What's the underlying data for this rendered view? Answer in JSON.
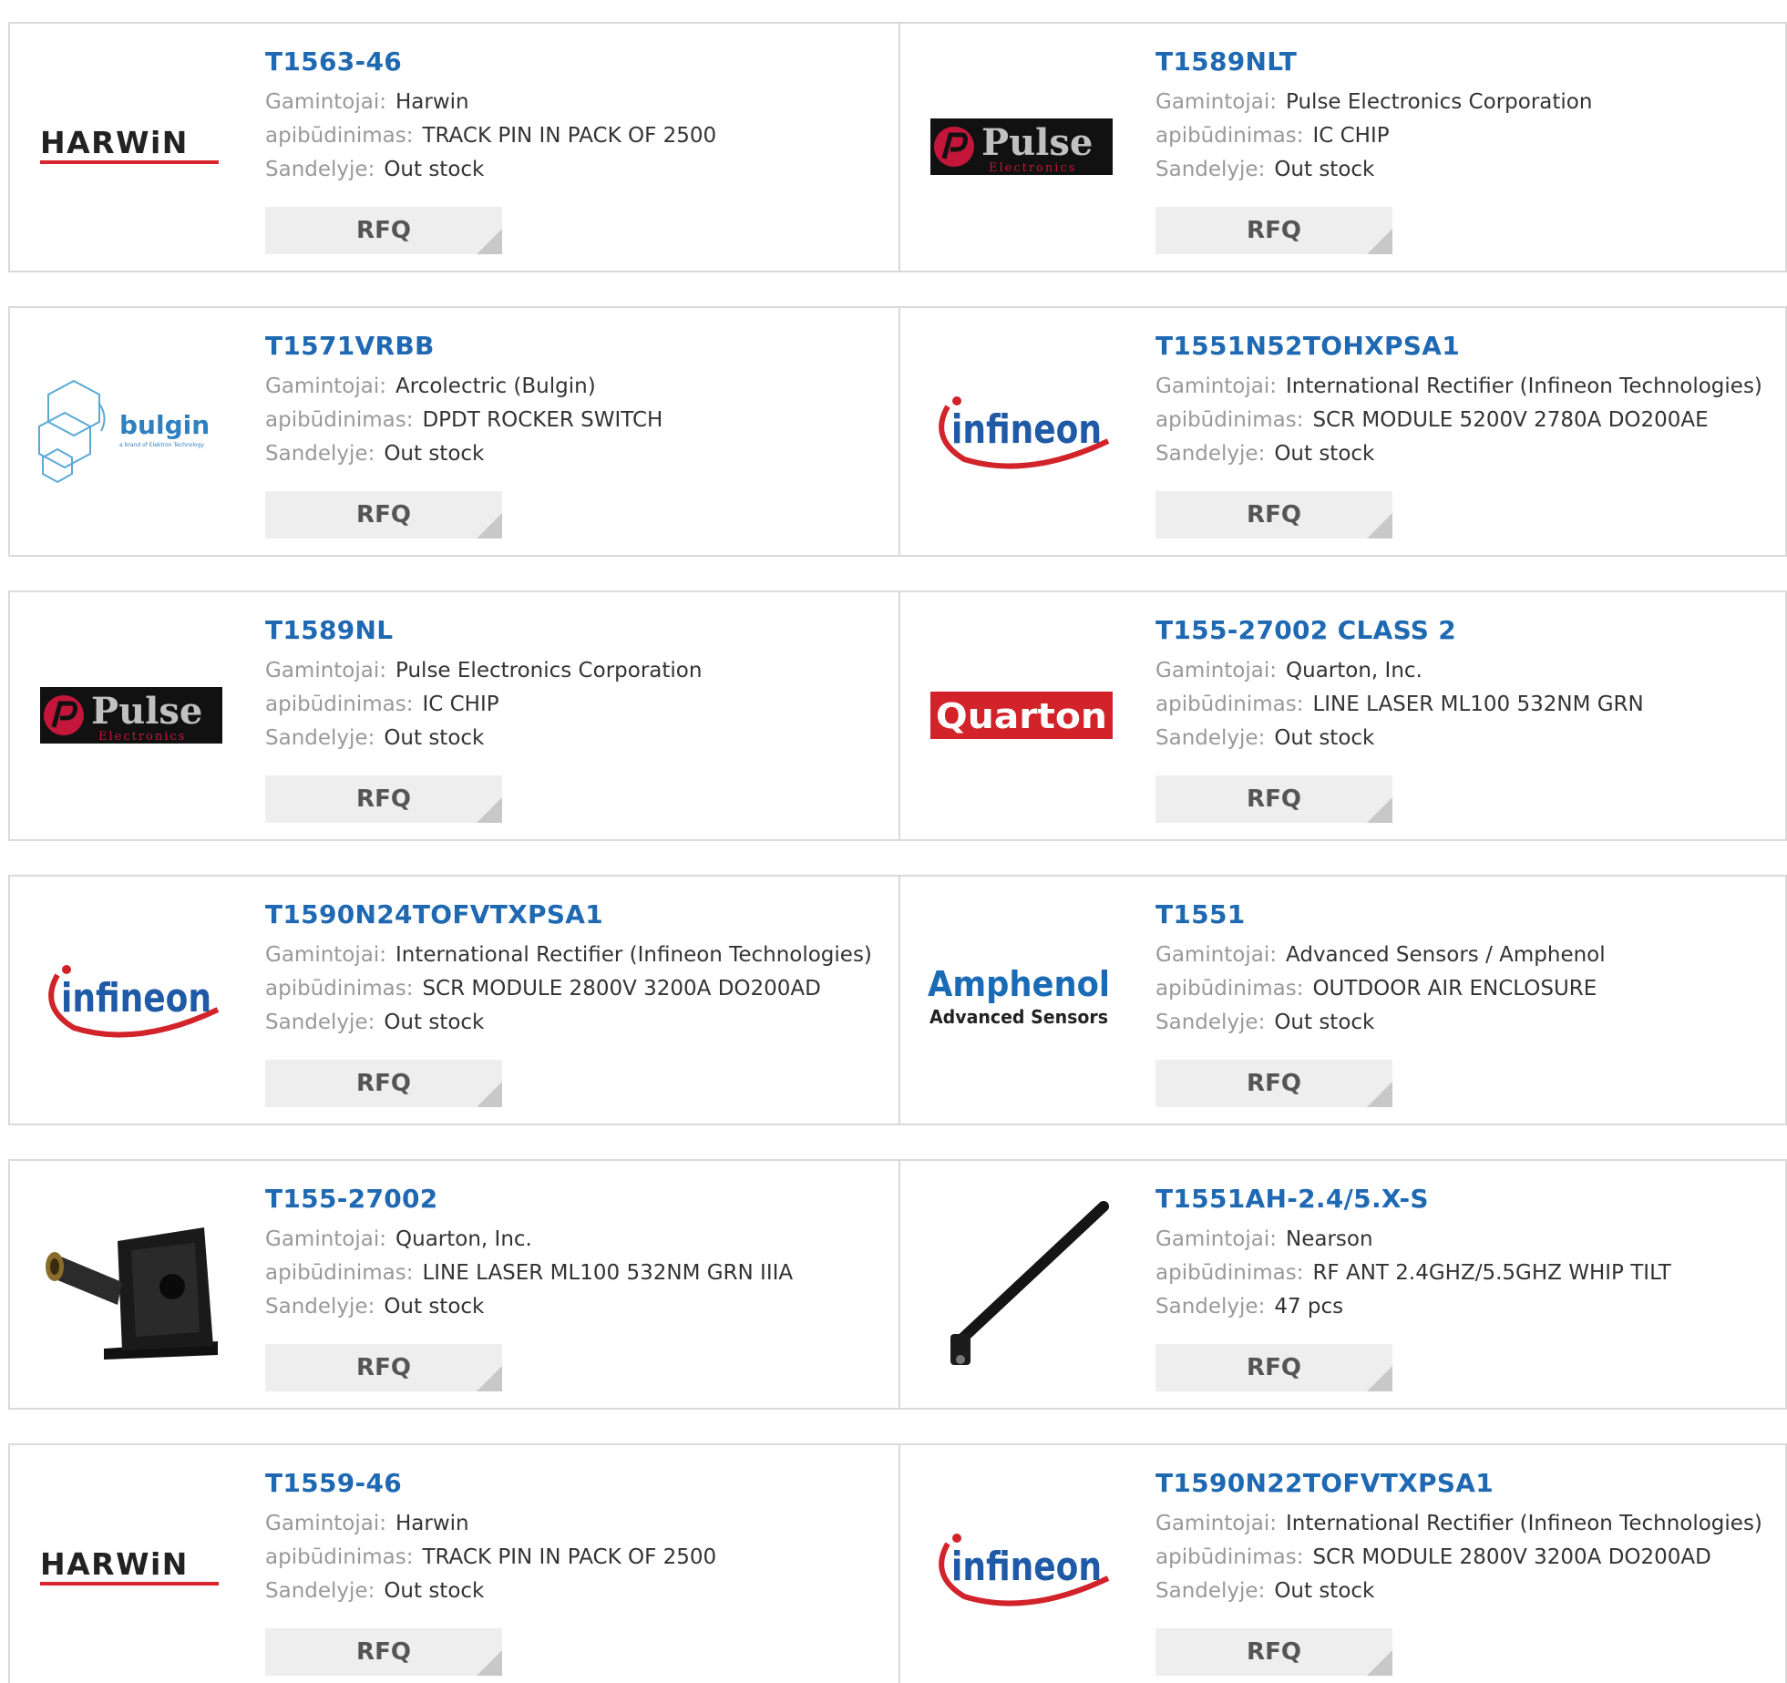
{
  "labels": {
    "manufacturer": "Gamintojai:",
    "description": "apibūdinimas:",
    "stock": "Sandelyje:",
    "rfq": "RFQ"
  },
  "products": [
    {
      "part": "T1563-46",
      "manufacturer": "Harwin",
      "description": "TRACK PIN IN PACK OF 2500",
      "stock": "Out stock",
      "logo": "harwin-logo",
      "logo_text": "HARWiN"
    },
    {
      "part": "T1589NLT",
      "manufacturer": "Pulse Electronics Corporation",
      "description": "IC CHIP",
      "stock": "Out stock",
      "logo": "pulse-logo",
      "logo_text": "Pulse",
      "logo_sub": "Electronics"
    },
    {
      "part": "T1571VRBB",
      "manufacturer": "Arcolectric (Bulgin)",
      "description": "DPDT ROCKER SWITCH",
      "stock": "Out stock",
      "logo": "bulgin-logo",
      "logo_text": "bulgin",
      "logo_sub": "a brand of Elektron Technology"
    },
    {
      "part": "T1551N52TOHXPSA1",
      "manufacturer": "International Rectifier (Infineon Technologies)",
      "description": "SCR MODULE 5200V 2780A DO200AE",
      "stock": "Out stock",
      "logo": "infineon-logo",
      "logo_text": "infineon"
    },
    {
      "part": "T1589NL",
      "manufacturer": "Pulse Electronics Corporation",
      "description": "IC CHIP",
      "stock": "Out stock",
      "logo": "pulse-logo",
      "logo_text": "Pulse",
      "logo_sub": "Electronics"
    },
    {
      "part": "T155-27002 CLASS 2",
      "manufacturer": "Quarton, Inc.",
      "description": "LINE LASER ML100 532NM GRN",
      "stock": "Out stock",
      "logo": "quarton-logo",
      "logo_text": "Quarton"
    },
    {
      "part": "T1590N24TOFVTXPSA1",
      "manufacturer": "International Rectifier (Infineon Technologies)",
      "description": "SCR MODULE 2800V 3200A DO200AD",
      "stock": "Out stock",
      "logo": "infineon-logo",
      "logo_text": "infineon"
    },
    {
      "part": "T1551",
      "manufacturer": "Advanced Sensors / Amphenol",
      "description": "OUTDOOR AIR ENCLOSURE",
      "stock": "Out stock",
      "logo": "amphenol-logo",
      "logo_text": "Amphenol",
      "logo_sub": "Advanced Sensors"
    },
    {
      "part": "T155-27002",
      "manufacturer": "Quarton, Inc.",
      "description": "LINE LASER ML100 532NM GRN IIIA",
      "stock": "Out stock",
      "logo": "laser-module-photo"
    },
    {
      "part": "T1551AH-2.4/5.X-S",
      "manufacturer": "Nearson",
      "description": "RF ANT 2.4GHZ/5.5GHZ WHIP TILT",
      "stock": "47 pcs",
      "logo": "antenna-photo"
    },
    {
      "part": "T1559-46",
      "manufacturer": "Harwin",
      "description": "TRACK PIN IN PACK OF 2500",
      "stock": "Out stock",
      "logo": "harwin-logo",
      "logo_text": "HARWiN"
    },
    {
      "part": "T1590N22TOFVTXPSA1",
      "manufacturer": "International Rectifier (Infineon Technologies)",
      "description": "SCR MODULE 2800V 3200A DO200AD",
      "stock": "Out stock",
      "logo": "infineon-logo",
      "logo_text": "infineon"
    }
  ],
  "colors": {
    "part_link": "#1f69b3",
    "label": "#999999",
    "border": "#d9d9d9",
    "rfq_bg": "#eeeeee",
    "harwin_red": "#d9232d",
    "infineon_blue": "#1f5aa6",
    "infineon_red": "#d2232a",
    "quarton_red": "#d2232a",
    "pulse_red": "#c4163a",
    "amphenol_blue": "#1a6bb5"
  }
}
